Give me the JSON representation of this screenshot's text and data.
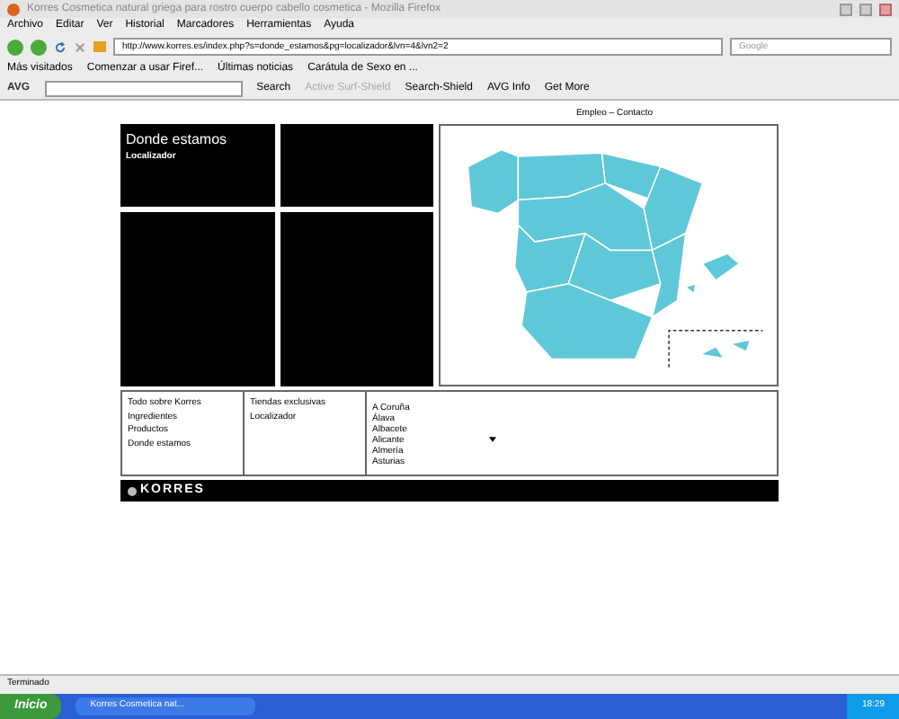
{
  "window": {
    "title": "Korres Cosmetica natural griega para rostro cuerpo cabello cosmetica - Mozilla Firefox"
  },
  "menu": [
    "Archivo",
    "Editar",
    "Ver",
    "Historial",
    "Marcadores",
    "Herramientas",
    "Ayuda"
  ],
  "address": {
    "value": "http://www.korres.es/index.php?s=donde_estamos&pg=localizador&lvn=4&lvn2=2"
  },
  "search": {
    "placeholder": "Google"
  },
  "bookmarks": [
    "Más visitados",
    "Comenzar a usar Firef...",
    "Últimas noticias",
    "Carátula de Sexo en ..."
  ],
  "avg_toolbar": {
    "brand": "AVG",
    "search_label": "Search",
    "items": [
      {
        "label": "Active Surf-Shield",
        "disabled": true
      },
      {
        "label": "Search-Shield",
        "disabled": false
      },
      {
        "label": "AVG Info",
        "disabled": false
      },
      {
        "label": "Get More",
        "disabled": false
      }
    ]
  },
  "page": {
    "top_links": "Empleo – Contacto",
    "heading": "Donde estamos",
    "subheading": "Localizador",
    "footer_col1": [
      "Todo sobre Korres",
      "Ingredientes",
      "Productos",
      "Donde estamos"
    ],
    "footer_col2": [
      "Tiendas exclusivas",
      "Localizador"
    ],
    "provinces": [
      "A Coruña",
      "Álava",
      "Albacete",
      "Alicante",
      "Almería",
      "Asturias"
    ],
    "brand": "KORRES"
  },
  "status_bar": "Terminado",
  "taskbar": {
    "start": "Inicio",
    "task": "Korres Cosmetica nat...",
    "clock": "18:29"
  }
}
